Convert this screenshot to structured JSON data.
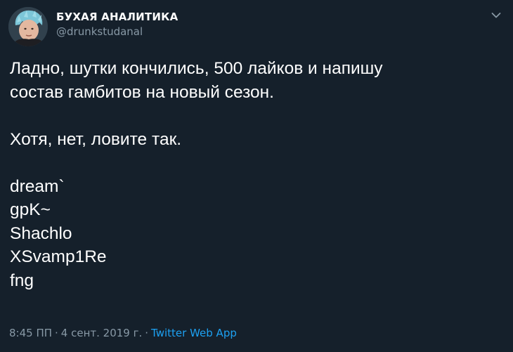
{
  "author": {
    "display_name": "БУХАЯ АНАЛИТИКА",
    "handle": "@drunkstudanal",
    "avatar_icon": "person-avatar-icon"
  },
  "menu": {
    "icon": "chevron-down-icon"
  },
  "tweet": {
    "lines": [
      "Ладно, шутки кончились, 500 лайков и напишу",
      "состав гамбитов на новый сезон.",
      "",
      "Хотя, нет, ловите так.",
      "",
      "dream`",
      "gpK~",
      "Shachlo",
      "XSvamp1Re",
      "fng"
    ]
  },
  "meta": {
    "time": "8:45 ПП",
    "separator": "·",
    "date": "4 сент. 2019 г.",
    "separator2": "·",
    "source": "Twitter Web App"
  },
  "colors": {
    "background": "#15202b",
    "text": "#ffffff",
    "secondary": "#8899a6",
    "accent": "#1da1f2"
  }
}
